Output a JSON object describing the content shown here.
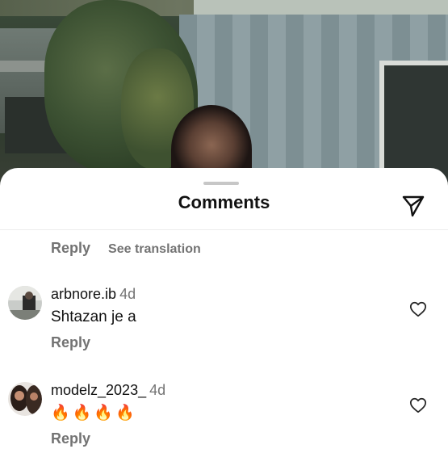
{
  "sheet": {
    "title": "Comments"
  },
  "top_reply": {
    "reply_label": "Reply",
    "translation_label": "See translation"
  },
  "comments": [
    {
      "username": "arbnore.ib",
      "time": "4d",
      "text": "Shtazan je a",
      "reply_label": "Reply"
    },
    {
      "username": "modelz_2023_",
      "time": "4d",
      "text": "🔥🔥🔥🔥",
      "reply_label": "Reply"
    }
  ],
  "icons": {
    "send": "paper-plane",
    "like": "heart-outline"
  }
}
